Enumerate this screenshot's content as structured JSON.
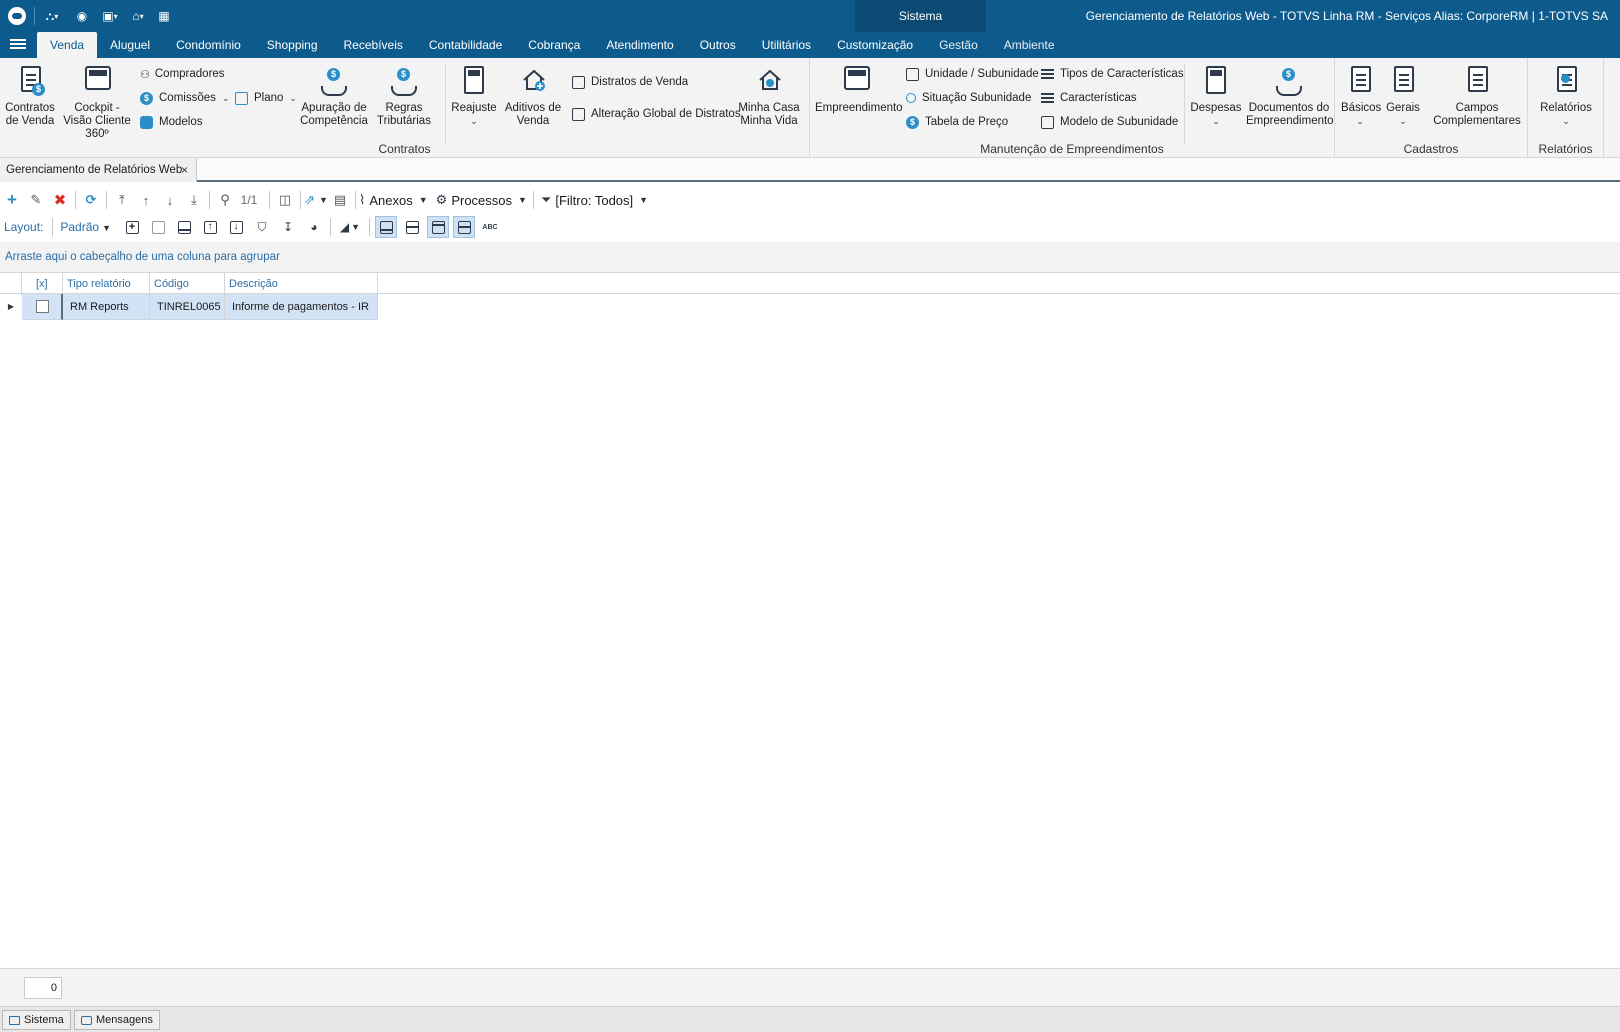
{
  "titlebar": {
    "section": "Sistema",
    "app_title": "Gerenciamento de Relatórios Web - TOTVS Linha RM - Serviços  Alias: CorporeRM | 1-TOTVS SA"
  },
  "menu": [
    "Venda",
    "Aluguel",
    "Condomínio",
    "Shopping",
    "Recebíveis",
    "Contabilidade",
    "Cobrança",
    "Atendimento",
    "Outros",
    "Utilitários",
    "Customização",
    "Gestão",
    "Ambiente"
  ],
  "ribbon": {
    "contratos": {
      "label": "Contratos",
      "contratos_venda": "Contratos de Venda",
      "cockpit": "Cockpit - Visão Cliente 360º",
      "compradores": "Compradores",
      "comissoes": "Comissões",
      "modelos": "Modelos",
      "plano": "Plano",
      "apuracao": "Apuração de Competência",
      "regras": "Regras Tributárias",
      "reajuste": "Reajuste",
      "aditivos": "Aditivos de Venda",
      "distratos": "Distratos de Venda",
      "alteracao": "Alteração Global de Distratos",
      "minha_casa": "Minha Casa Minha Vida"
    },
    "manutencao": {
      "label": "Manutenção de Empreendimentos",
      "empreendimento": "Empreendimento",
      "unidade": "Unidade / Subunidade",
      "situacao": "Situação Subunidade",
      "tabela": "Tabela de Preço",
      "tipos": "Tipos de Características",
      "caracteristicas": "Características",
      "modelo_sub": "Modelo de Subunidade"
    },
    "cadastros": {
      "label": "Cadastros",
      "despesas": "Despesas",
      "documentos": "Documentos do Empreendimento",
      "basicos": "Básicos",
      "gerais": "Gerais",
      "campos": "Campos Complementares"
    },
    "relatorios": {
      "label": "Relatórios",
      "relatorios_btn": "Relatórios"
    }
  },
  "doc_tab": {
    "title": "Gerenciamento de Relatórios Web",
    "close": "×"
  },
  "toolbar": {
    "pager": "1/1",
    "anexos": "Anexos",
    "processos": "Processos",
    "filtro": "[Filtro: Todos]"
  },
  "layout_bar": {
    "label": "Layout:",
    "value": "Padrão"
  },
  "group_panel": "Arraste aqui o cabeçalho de uma coluna para agrupar",
  "grid": {
    "columns": [
      "[x]",
      "Tipo relatório",
      "Código",
      "Descrição"
    ],
    "rows": [
      {
        "tipo": "RM Reports",
        "codigo": "TINREL0065",
        "descricao": "Informe de pagamentos - IR"
      }
    ]
  },
  "footer": {
    "count": "0"
  },
  "statusbar": {
    "sistema": "Sistema",
    "mensagens": "Mensagens"
  },
  "colors": {
    "title_bg": "#0d5b8c",
    "selected_row": "#d2e3f5",
    "link_blue": "#2b6ea6",
    "delete_red": "#d93025"
  }
}
